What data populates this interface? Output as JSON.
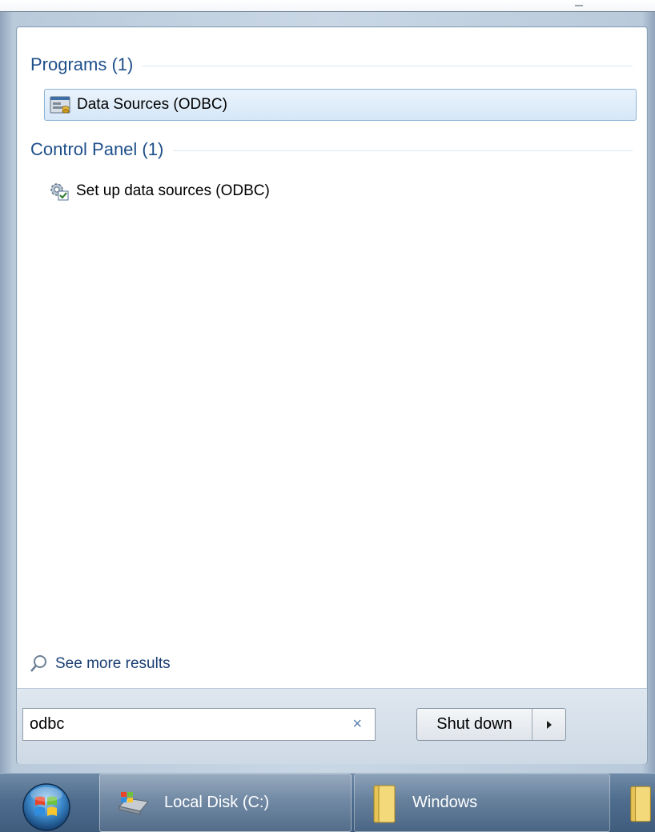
{
  "start_menu": {
    "groups": [
      {
        "title": "Programs (1)",
        "items": [
          {
            "label": "Data Sources (ODBC)",
            "icon": "odbc-program-icon",
            "selected": true
          }
        ]
      },
      {
        "title": "Control Panel (1)",
        "items": [
          {
            "label": "Set up data sources (ODBC)",
            "icon": "control-panel-gear-icon",
            "selected": false
          }
        ]
      }
    ],
    "see_more": {
      "label": "See more results",
      "icon": "search-icon"
    },
    "search": {
      "value": "odbc",
      "clear_icon": "×"
    },
    "shutdown": {
      "label": "Shut down",
      "arrow_icon": "triangle-right-icon"
    }
  },
  "taskbar": {
    "start_icon": "windows-start-orb-icon",
    "items": [
      {
        "label": "Local Disk (C:)",
        "icon": "drive-icon"
      },
      {
        "label": "Windows",
        "icon": "folder-icon"
      }
    ]
  },
  "colors": {
    "group_title": "#1e4f8a",
    "link": "#1a3e72",
    "selection_border": "#8cb3d8",
    "taskbar": "#4f6d8e"
  }
}
